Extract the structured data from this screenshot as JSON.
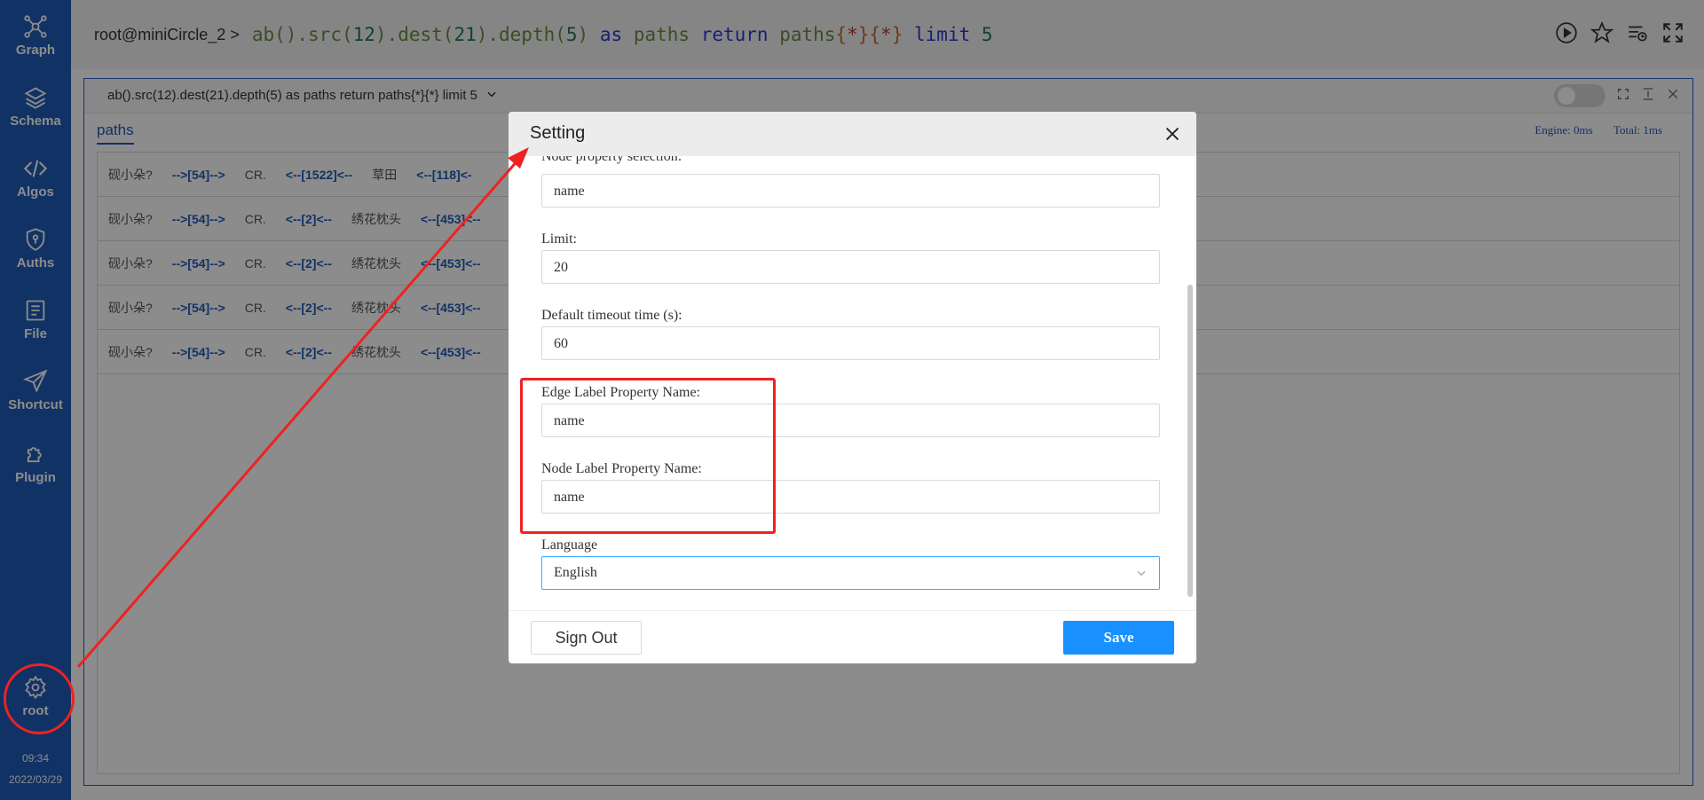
{
  "sidebar": {
    "items": [
      {
        "label": "Graph",
        "icon": "graph-icon"
      },
      {
        "label": "Schema",
        "icon": "layers-icon"
      },
      {
        "label": "Algos",
        "icon": "code-icon"
      },
      {
        "label": "Auths",
        "icon": "shield-icon"
      },
      {
        "label": "File",
        "icon": "file-icon"
      },
      {
        "label": "Shortcut",
        "icon": "send-icon"
      },
      {
        "label": "Plugin",
        "icon": "puzzle-icon"
      }
    ],
    "user": {
      "label": "root",
      "icon": "gear-icon"
    },
    "time": "09:34",
    "date": "2022/03/29"
  },
  "header": {
    "prompt": "root@miniCircle_2 >",
    "query": {
      "fn1": "ab().src(",
      "n1": "12",
      "fn2": ").dest(",
      "n2": "21",
      "fn3": ").depth(",
      "n3": "5",
      "fn4": ")",
      "kw1": "as",
      "word1": "paths",
      "kw2": "return",
      "word2": "paths",
      "b1": "{",
      "s1": "*",
      "b2": "}",
      "b3": "{",
      "s2": "*",
      "b4": "}",
      "kw3": "limit",
      "n4": "5"
    }
  },
  "result": {
    "title": "ab().src(12).dest(21).depth(5) as paths return paths{*}{*} limit 5",
    "tab": "paths",
    "engine": "Engine: 0ms",
    "total": "Total: 1ms",
    "rows": [
      [
        "砚小朵?",
        "-->[54]-->",
        "CR.",
        "<--[1522]<--",
        "草田",
        "<--[118]<-"
      ],
      [
        "砚小朵?",
        "-->[54]-->",
        "CR.",
        "<--[2]<--",
        "绣花枕头",
        "<--[453]<--"
      ],
      [
        "砚小朵?",
        "-->[54]-->",
        "CR.",
        "<--[2]<--",
        "绣花枕头",
        "<--[453]<--"
      ],
      [
        "砚小朵?",
        "-->[54]-->",
        "CR.",
        "<--[2]<--",
        "绣花枕头",
        "<--[453]<--"
      ],
      [
        "砚小朵?",
        "-->[54]-->",
        "CR.",
        "<--[2]<--",
        "绣花枕头",
        "<--[453]<--"
      ]
    ]
  },
  "dialog": {
    "title": "Setting",
    "fields": {
      "node_property_label": "Node property selection:",
      "node_property_value": "name",
      "limit_label": "Limit:",
      "limit_value": "20",
      "timeout_label": "Default timeout time (s):",
      "timeout_value": "60",
      "edge_label_label": "Edge Label Property Name:",
      "edge_label_value": "name",
      "node_label_label": "Node Label Property Name:",
      "node_label_value": "name",
      "language_label": "Language",
      "language_value": "English"
    },
    "signout_label": "Sign Out",
    "save_label": "Save"
  },
  "colors": {
    "sidebar": "#1f5bb8",
    "primary": "#1890ff",
    "annotation": "#ee2222"
  }
}
